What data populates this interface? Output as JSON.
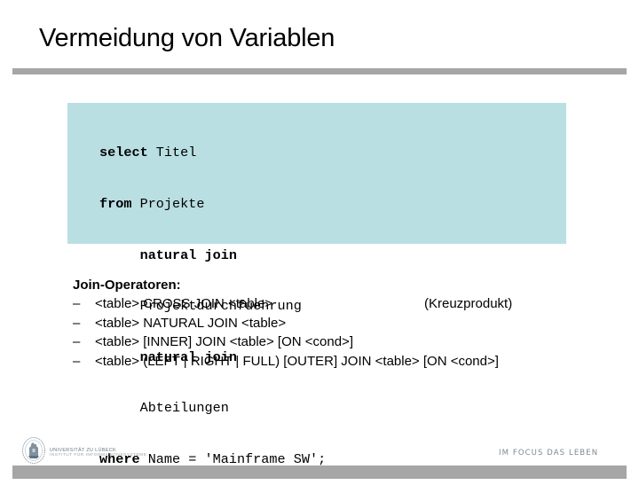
{
  "slide": {
    "title": "Vermeidung von Variablen"
  },
  "code": {
    "lines": [
      {
        "keyword": "select",
        "rest": " Titel",
        "indent": ""
      },
      {
        "keyword": "from",
        "rest": " Projekte",
        "indent": ""
      },
      {
        "keyword": "natural join",
        "rest": "",
        "indent": "     "
      },
      {
        "keyword": "",
        "rest": "Projektdurchfuehrung",
        "indent": "     "
      },
      {
        "keyword": "natural join",
        "rest": "",
        "indent": "     "
      },
      {
        "keyword": "",
        "rest": "Abteilungen",
        "indent": "     "
      },
      {
        "keyword": "where",
        "rest": " Name = 'Mainframe SW';",
        "indent": ""
      }
    ],
    "background_color": "#badfe3"
  },
  "join_operators": {
    "heading": "Join-Operatoren:",
    "bullet": "–",
    "items": [
      {
        "text": "<table> CROSS JOIN <table>",
        "note": "(Kreuzprodukt)"
      },
      {
        "text": "<table> NATURAL JOIN <table>",
        "note": ""
      },
      {
        "text": "<table> [INNER] JOIN <table> [ON <cond>]",
        "note": ""
      },
      {
        "text": "<table> (LEFT | RIGHT | FULL) [OUTER] JOIN <table> [ON <cond>]",
        "note": ""
      }
    ]
  },
  "footer": {
    "logo_icon": "university-seal-icon",
    "university_name": "UNIVERSITÄT ZU LÜBECK",
    "institute_name": "INSTITUT FÜR INFORMATIONSSYSTEME",
    "slogan": "IM FOCUS DAS LEBEN"
  },
  "colors": {
    "rule": "#a6a6a6",
    "text": "#000000",
    "footer_text": "#7d8a90"
  }
}
